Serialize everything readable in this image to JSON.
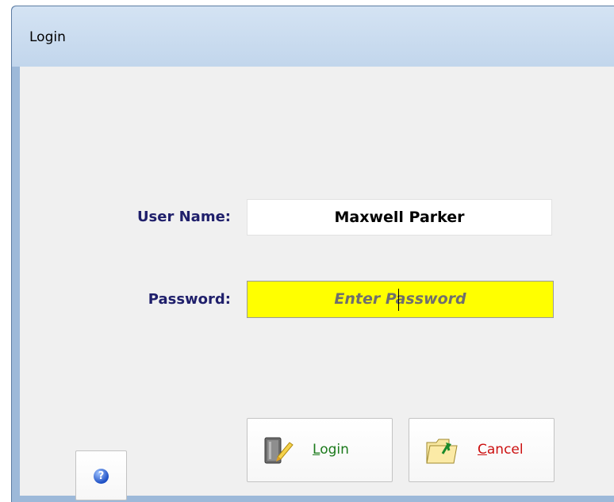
{
  "window": {
    "title": "Login"
  },
  "form": {
    "username_label": "User Name:",
    "username_value": "Maxwell Parker",
    "password_label": "Password:",
    "password_placeholder": "Enter Password"
  },
  "buttons": {
    "login_first": "L",
    "login_rest": "ogin",
    "cancel_first": "C",
    "cancel_rest": "ancel"
  },
  "icons": {
    "help": "help-icon",
    "login": "login-key-icon",
    "cancel": "cancel-folder-icon"
  },
  "colors": {
    "label": "#1f1f6b",
    "password_field_bg": "#ffff00",
    "login_text": "#1b7a1b",
    "cancel_text": "#cc1010"
  }
}
